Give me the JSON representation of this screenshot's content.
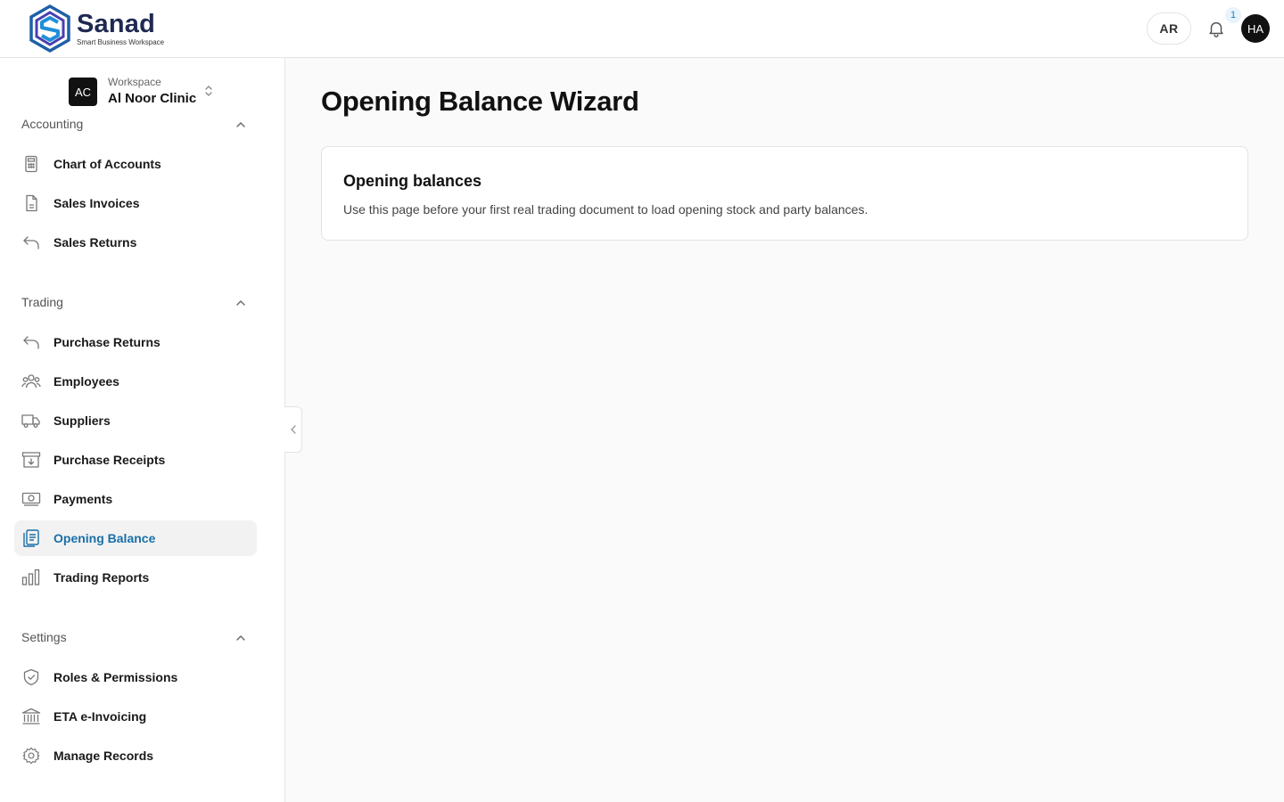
{
  "header": {
    "logo_name": "Sanad",
    "logo_tagline": "Smart Business Workspace",
    "lang_button": "AR",
    "notification_count": "1",
    "avatar_initials": "HA"
  },
  "workspace": {
    "badge": "AC",
    "label": "Workspace",
    "name": "Al Noor Clinic"
  },
  "sidebar": {
    "sections": [
      {
        "title": "Accounting",
        "items": [
          {
            "label": "Chart of Accounts",
            "icon": "calculator-icon"
          },
          {
            "label": "Sales Invoices",
            "icon": "document-icon"
          },
          {
            "label": "Sales Returns",
            "icon": "return-arrow-icon"
          }
        ]
      },
      {
        "title": "Trading",
        "items": [
          {
            "label": "Purchase Returns",
            "icon": "return-arrow-icon"
          },
          {
            "label": "Employees",
            "icon": "users-icon"
          },
          {
            "label": "Suppliers",
            "icon": "truck-icon"
          },
          {
            "label": "Purchase Receipts",
            "icon": "archive-download-icon"
          },
          {
            "label": "Payments",
            "icon": "banknote-icon"
          },
          {
            "label": "Opening Balance",
            "icon": "clipboard-icon",
            "active": true
          },
          {
            "label": "Trading Reports",
            "icon": "bar-chart-icon"
          }
        ]
      },
      {
        "title": "Settings",
        "items": [
          {
            "label": "Roles & Permissions",
            "icon": "shield-check-icon"
          },
          {
            "label": "ETA e-Invoicing",
            "icon": "bank-icon"
          },
          {
            "label": "Manage Records",
            "icon": "gear-icon"
          }
        ]
      }
    ]
  },
  "main": {
    "title": "Opening Balance Wizard",
    "card": {
      "title": "Opening balances",
      "description": "Use this page before your first real trading document to load opening stock and party balances."
    }
  },
  "colors": {
    "accent": "#1a6fa8",
    "brand_dark": "#1f2a52",
    "active_bg": "#f2f2f2"
  }
}
